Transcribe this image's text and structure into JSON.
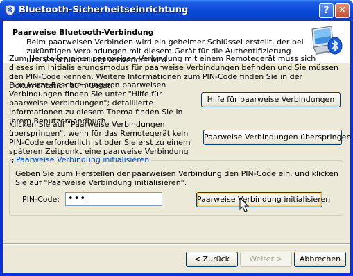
{
  "window": {
    "title": "Bluetooth-Sicherheitseinrichtung",
    "help_button": "?",
    "close_button": "✕"
  },
  "header": {
    "title": "Paarweise Bluetooth-Verbindung",
    "description": "Beim paarweisen Verbinden wird ein geheimer Schlüssel erstellt, der bei zukünftigen Verbindungen mit diesem Gerät für die Authentifizierung und Verschlüsselung verwendet wird."
  },
  "body": {
    "intro": "Zum Herstellen einer paarweisen Verbindung mit einem Remotegerät muss sich dieses im Initialisierungsmodus für paarweise Verbindungen befinden und Sie müssen den PIN-Code kennen. Weitere Informationen zum PIN-Code finden Sie in der Dokumentation zum Gerät.",
    "help_text": "Eine kurze Beschreibung von paarweisen Verbindungen finden Sie unter \"Hilfe für paarweise Verbindungen\"; detaillierte Informationen zu diesem Thema finden Sie in Ihrem Benutzerhandbuch.",
    "help_button": "Hilfe für paarweise Verbindungen",
    "skip_text": "Klicken Sie auf \"Paarweise Verbindungen überspringen\", wenn für das Remotegerät kein PIN-Code erforderlich ist oder Sie erst zu einem späteren Zeitpunkt eine paarweise Verbindung mit dem Gerät herstellen möchten.",
    "skip_button": "Paarweise Verbindungen überspringen"
  },
  "group": {
    "title": "Paarweise Verbindung initialisieren",
    "instructions": "Geben Sie zum Herstellen der paarweisen Verbindung den PIN-Code ein, und klicken Sie auf \"Paarweise Verbindung initialisieren\".",
    "pin_label": "PIN-Code:",
    "pin_value": "•••",
    "init_button": "Paarweise Verbindung initialisieren"
  },
  "footer": {
    "back_button": "< Zurück",
    "next_button": "Weiter >",
    "cancel_button": "Abbrechen"
  },
  "colors": {
    "titlebar": "#0a4ad9",
    "dialog_bg": "#ece9d8",
    "group_title": "#0046d5"
  },
  "icons": {
    "title": "bluetooth-shield-icon",
    "header": "laptop-bluetooth-icon"
  }
}
